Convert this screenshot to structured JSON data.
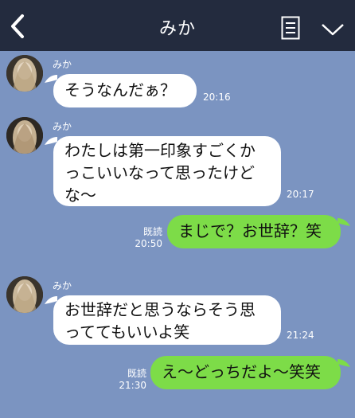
{
  "header": {
    "title": "みか",
    "back_icon": "chevron-left-icon",
    "menu_icon": "notes-icon",
    "dropdown_icon": "chevron-down-icon"
  },
  "colors": {
    "chat_background": "#7b94c1",
    "header_background": "#232b3e",
    "incoming_bubble": "#ffffff",
    "outgoing_bubble": "#7ddc48"
  },
  "messages": [
    {
      "direction": "in",
      "sender": "みか",
      "text": "そうなんだぁ？",
      "time": "20:16"
    },
    {
      "direction": "in",
      "sender": "みか",
      "lines": [
        "わたしは第一印象すごくか",
        "っこいいなって思ったけど",
        "な〜"
      ],
      "time": "20:17"
    },
    {
      "direction": "out",
      "text": "まじで？お世辞？笑",
      "read": "既読",
      "time": "20:50"
    },
    {
      "direction": "in",
      "sender": "みか",
      "lines": [
        "お世辞だと思うならそう思",
        "っててもいいよ笑"
      ],
      "time": "21:24"
    },
    {
      "direction": "out",
      "text": "え〜どっちだよ〜笑笑",
      "read": "既読",
      "time": "21:30"
    }
  ]
}
